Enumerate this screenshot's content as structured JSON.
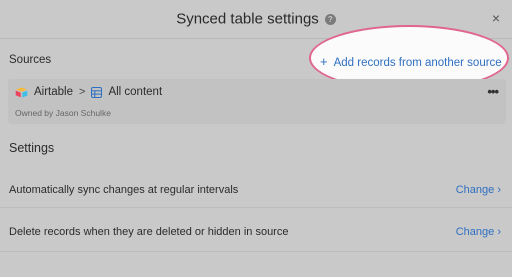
{
  "header": {
    "title": "Synced table settings",
    "help_icon": "?",
    "close_icon": "×"
  },
  "sources": {
    "label": "Sources",
    "add_button_plus": "+",
    "add_button_label": "Add records from another source",
    "card": {
      "base_name": "Airtable",
      "separator": ">",
      "view_name": "All content",
      "owner": "Owned by Jason Schulke",
      "more_icon": "•••"
    }
  },
  "settings": {
    "label": "Settings",
    "rows": [
      {
        "bold": "Automatically sync changes",
        "rest": " at regular intervals",
        "action": "Change"
      },
      {
        "bold": "Delete records",
        "rest": " when they are deleted or hidden in source",
        "action": "Change"
      }
    ],
    "chevron": "›"
  },
  "colors": {
    "accent": "#2f6fc2",
    "highlight_ring": "#e0658f",
    "overlay_background": "#c9c9c9"
  },
  "icons": [
    "help-icon",
    "close-icon",
    "plus-icon",
    "airtable-logo-icon",
    "chevron-right-icon",
    "grid-table-icon",
    "more-icon"
  ]
}
